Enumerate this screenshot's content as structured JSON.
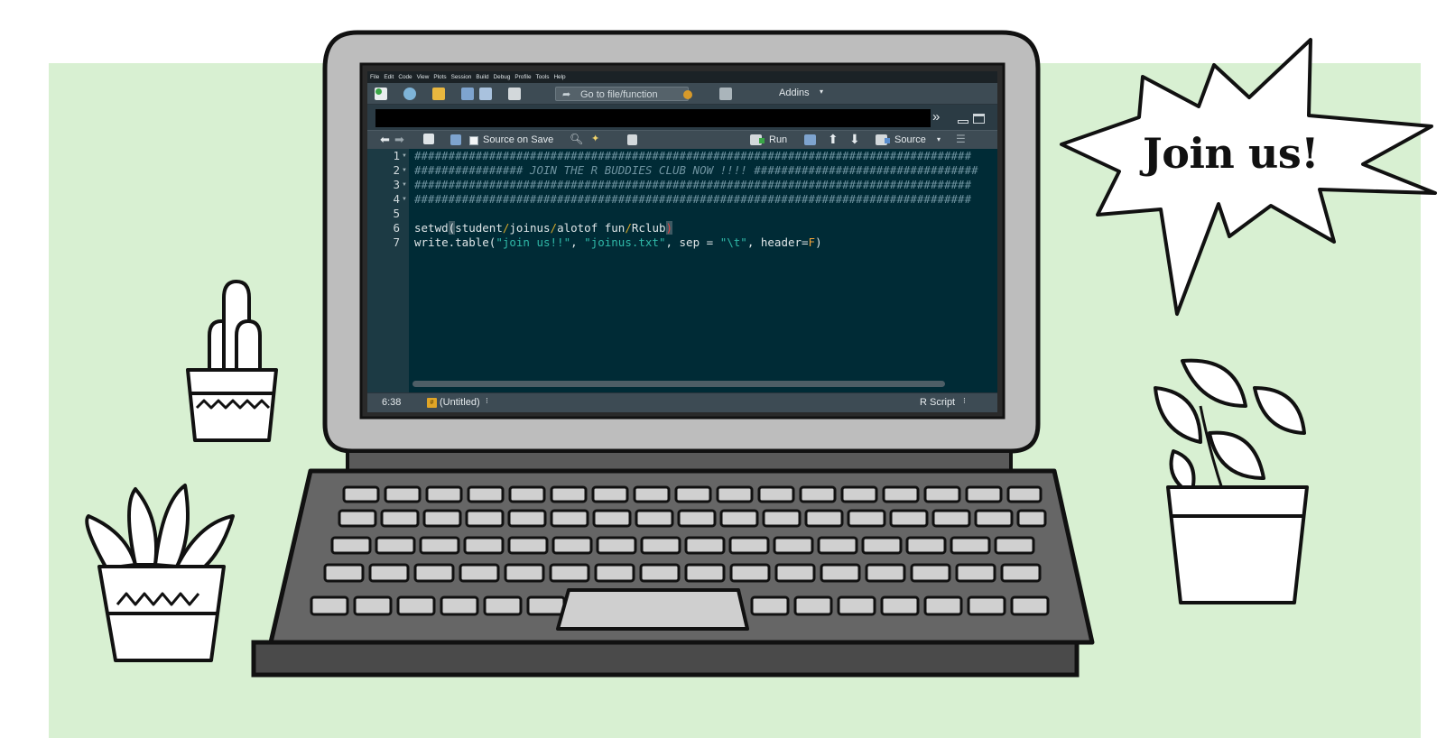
{
  "menu": [
    "File",
    "Edit",
    "Code",
    "View",
    "Plots",
    "Session",
    "Build",
    "Debug",
    "Profile",
    "Tools",
    "Help"
  ],
  "toolbar": {
    "goto_label": "Go to file/function",
    "addins_label": "Addins"
  },
  "tabbar": {
    "more_icon": "»"
  },
  "editor_toolbar": {
    "source_on_save": "Source on Save",
    "run": "Run",
    "source": "Source"
  },
  "editor": {
    "line_numbers": [
      "1",
      "2",
      "3",
      "4",
      "5",
      "6",
      "7"
    ],
    "comment_line": "##################################################################################",
    "title_line": "################ JOIN THE R BUDDIES CLUB NOW !!!! #################################",
    "setwd": {
      "fn": "setwd",
      "open": "(",
      "a": "student",
      "s1": "/",
      "b": "joinus",
      "s2": "/",
      "c": "alotof fun",
      "s3": "/",
      "d": "Rclub",
      "close": ")"
    },
    "write": {
      "fn": "write.table(",
      "arg1": "\"join us!!\"",
      "c1": ", ",
      "arg2": "\"joinus.txt\"",
      "c2": ", sep = ",
      "arg3": "\"\\t\"",
      "c3": ", header=",
      "arg4": "F",
      "close": ")"
    }
  },
  "status": {
    "cursor": "6:38",
    "file_label": "(Untitled)",
    "file_icon": "#",
    "script_type": "R Script",
    "caret": "⁝"
  },
  "callout": {
    "text": "Join us!"
  },
  "colors": {
    "background": "#d8f0d2",
    "editor_bg": "#002b36",
    "string": "#2fb8a8",
    "constant": "#f2a33a"
  }
}
